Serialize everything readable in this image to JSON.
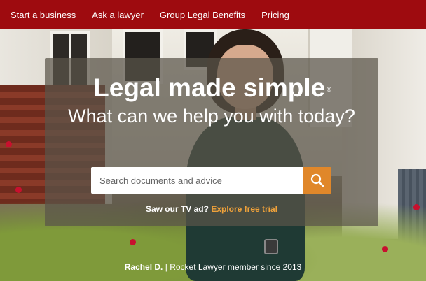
{
  "nav": {
    "items": [
      {
        "label": "Start a business"
      },
      {
        "label": "Ask a lawyer"
      },
      {
        "label": "Group Legal Benefits"
      },
      {
        "label": "Pricing"
      }
    ]
  },
  "hero": {
    "headline": "Legal made simple",
    "registered_mark": "®",
    "subheadline": "What can we help you with today?",
    "search": {
      "placeholder": "Search documents and advice",
      "value": ""
    },
    "tv_prompt": "Saw our TV ad?",
    "tv_link": "Explore free trial",
    "caption_name": "Rachel D.",
    "caption_separator": "|",
    "caption_text": "Rocket Lawyer member since 2013"
  },
  "colors": {
    "nav_bg": "#9e0b0f",
    "accent_orange": "#e0872a",
    "link_orange": "#f0a23a"
  },
  "icons": {
    "search_button": "search-icon"
  }
}
